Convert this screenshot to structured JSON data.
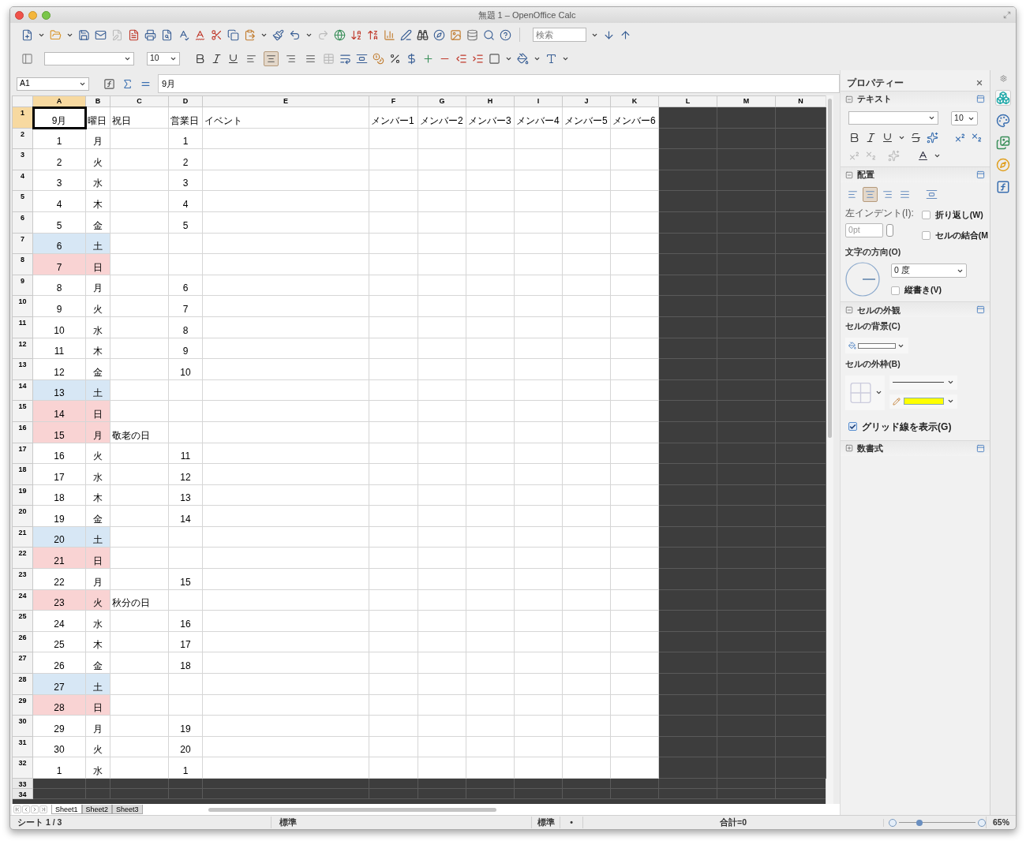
{
  "window": {
    "title": "無題 1 – OpenOffice Calc"
  },
  "toolbar": {
    "search": {
      "placeholder": "検索"
    },
    "font_size": "10",
    "align_buttons": [
      {
        "selected": false
      },
      {
        "selected": true
      },
      {
        "selected": false
      },
      {
        "selected": false
      }
    ]
  },
  "formula_bar": {
    "cell_ref": "A1",
    "content": "9月"
  },
  "sheet": {
    "columns": [
      {
        "label": "A",
        "selected": true,
        "shaded": false
      },
      {
        "label": "B",
        "selected": false,
        "shaded": false
      },
      {
        "label": "C",
        "selected": false,
        "shaded": false
      },
      {
        "label": "D",
        "selected": false,
        "shaded": false
      },
      {
        "label": "E",
        "selected": false,
        "shaded": false
      },
      {
        "label": "F",
        "selected": false,
        "shaded": false
      },
      {
        "label": "G",
        "selected": false,
        "shaded": false
      },
      {
        "label": "H",
        "selected": false,
        "shaded": false
      },
      {
        "label": "I",
        "selected": false,
        "shaded": false
      },
      {
        "label": "J",
        "selected": false,
        "shaded": false
      },
      {
        "label": "K",
        "selected": false,
        "shaded": false
      },
      {
        "label": "L",
        "selected": false,
        "shaded": true
      },
      {
        "label": "M",
        "selected": false,
        "shaded": true
      },
      {
        "label": "N",
        "selected": false,
        "shaded": true
      }
    ],
    "header_row": {
      "label": "1",
      "selected": true,
      "cells": [
        {
          "text": "9月",
          "selected": true
        },
        {
          "text": "曜日",
          "selected": false
        },
        {
          "text": "祝日",
          "selected": false
        },
        {
          "text": "営業日",
          "selected": false
        },
        {
          "text": "イベント",
          "selected": false
        },
        {
          "text": "メンバー1",
          "selected": false
        },
        {
          "text": "メンバー2",
          "selected": false
        },
        {
          "text": "メンバー3",
          "selected": false
        },
        {
          "text": "メンバー4",
          "selected": false
        },
        {
          "text": "メンバー5",
          "selected": false
        },
        {
          "text": "メンバー6",
          "selected": false
        }
      ]
    },
    "rows": [
      {
        "label": "2",
        "day": "1",
        "weekday": "月",
        "business_day": "1",
        "kind": "weekday"
      },
      {
        "label": "3",
        "day": "2",
        "weekday": "火",
        "business_day": "2",
        "kind": "weekday"
      },
      {
        "label": "4",
        "day": "3",
        "weekday": "水",
        "business_day": "3",
        "kind": "weekday"
      },
      {
        "label": "5",
        "day": "4",
        "weekday": "木",
        "business_day": "4",
        "kind": "weekday"
      },
      {
        "label": "6",
        "day": "5",
        "weekday": "金",
        "business_day": "5",
        "kind": "weekday"
      },
      {
        "label": "7",
        "day": "6",
        "weekday": "土",
        "kind": "saturday"
      },
      {
        "label": "8",
        "day": "7",
        "weekday": "日",
        "kind": "holiday"
      },
      {
        "label": "9",
        "day": "8",
        "weekday": "月",
        "business_day": "6",
        "kind": "weekday"
      },
      {
        "label": "10",
        "day": "9",
        "weekday": "火",
        "business_day": "7",
        "kind": "weekday"
      },
      {
        "label": "11",
        "day": "10",
        "weekday": "水",
        "business_day": "8",
        "kind": "weekday"
      },
      {
        "label": "12",
        "day": "11",
        "weekday": "木",
        "business_day": "9",
        "kind": "weekday"
      },
      {
        "label": "13",
        "day": "12",
        "weekday": "金",
        "business_day": "10",
        "kind": "weekday"
      },
      {
        "label": "14",
        "day": "13",
        "weekday": "土",
        "kind": "saturday"
      },
      {
        "label": "15",
        "day": "14",
        "weekday": "日",
        "kind": "holiday"
      },
      {
        "label": "16",
        "day": "15",
        "weekday": "月",
        "holiday": "敬老の日",
        "kind": "holiday"
      },
      {
        "label": "17",
        "day": "16",
        "weekday": "火",
        "business_day": "11",
        "kind": "weekday"
      },
      {
        "label": "18",
        "day": "17",
        "weekday": "水",
        "business_day": "12",
        "kind": "weekday"
      },
      {
        "label": "19",
        "day": "18",
        "weekday": "木",
        "business_day": "13",
        "kind": "weekday"
      },
      {
        "label": "20",
        "day": "19",
        "weekday": "金",
        "business_day": "14",
        "kind": "weekday"
      },
      {
        "label": "21",
        "day": "20",
        "weekday": "土",
        "kind": "saturday"
      },
      {
        "label": "22",
        "day": "21",
        "weekday": "日",
        "kind": "holiday"
      },
      {
        "label": "23",
        "day": "22",
        "weekday": "月",
        "business_day": "15",
        "kind": "weekday"
      },
      {
        "label": "24",
        "day": "23",
        "weekday": "火",
        "holiday": "秋分の日",
        "kind": "holiday"
      },
      {
        "label": "25",
        "day": "24",
        "weekday": "水",
        "business_day": "16",
        "kind": "weekday"
      },
      {
        "label": "26",
        "day": "25",
        "weekday": "木",
        "business_day": "17",
        "kind": "weekday"
      },
      {
        "label": "27",
        "day": "26",
        "weekday": "金",
        "business_day": "18",
        "kind": "weekday"
      },
      {
        "label": "28",
        "day": "27",
        "weekday": "土",
        "kind": "saturday"
      },
      {
        "label": "29",
        "day": "28",
        "weekday": "日",
        "kind": "holiday"
      },
      {
        "label": "30",
        "day": "29",
        "weekday": "月",
        "business_day": "19",
        "kind": "weekday"
      },
      {
        "label": "31",
        "day": "30",
        "weekday": "火",
        "business_day": "20",
        "kind": "weekday"
      },
      {
        "label": "32",
        "day": "1",
        "weekday": "水",
        "business_day": "1",
        "kind": "weekday"
      }
    ],
    "shaded_rows": [
      {
        "label": "33"
      },
      {
        "label": "34"
      }
    ]
  },
  "sheet_tabs": [
    {
      "label": "Sheet1",
      "selected": true
    },
    {
      "label": "Sheet2",
      "selected": false
    },
    {
      "label": "Sheet3",
      "selected": false
    }
  ],
  "sidebar": {
    "title": "プロパティー",
    "sections": [
      {
        "kind": "text",
        "title": "テキスト",
        "expanded": true,
        "font_size": "10"
      },
      {
        "kind": "alignment",
        "title": "配置",
        "expanded": true,
        "align_buttons": [
          {
            "selected": false
          },
          {
            "selected": true
          },
          {
            "selected": false
          },
          {
            "selected": false
          }
        ],
        "indent_label": "左インデント(I):",
        "indent_value": "0pt",
        "wrap": {
          "label": "折り返し(W)",
          "checked": false
        },
        "merge": {
          "label": "セルの結合(M",
          "checked": false
        },
        "orientation_label": "文字の方向(O)",
        "angle": "0 度",
        "vertical": {
          "label": "縦書き(V)",
          "checked": false
        }
      },
      {
        "kind": "appearance",
        "title": "セルの外観",
        "expanded": true,
        "background_label": "セルの背景(C)",
        "border_label": "セルの外枠(B)",
        "gridlines": {
          "label": "グリッド線を表示(G)",
          "checked": true
        }
      },
      {
        "kind": "number",
        "title": "数書式",
        "expanded": false
      }
    ]
  },
  "status_bar": {
    "sheet": "シート 1 / 3",
    "page_style": "標準",
    "mode": "標準",
    "modified": "•",
    "sum": "合計=0",
    "zoom": {
      "level": 0.27
    },
    "zoom_text": "65%"
  }
}
